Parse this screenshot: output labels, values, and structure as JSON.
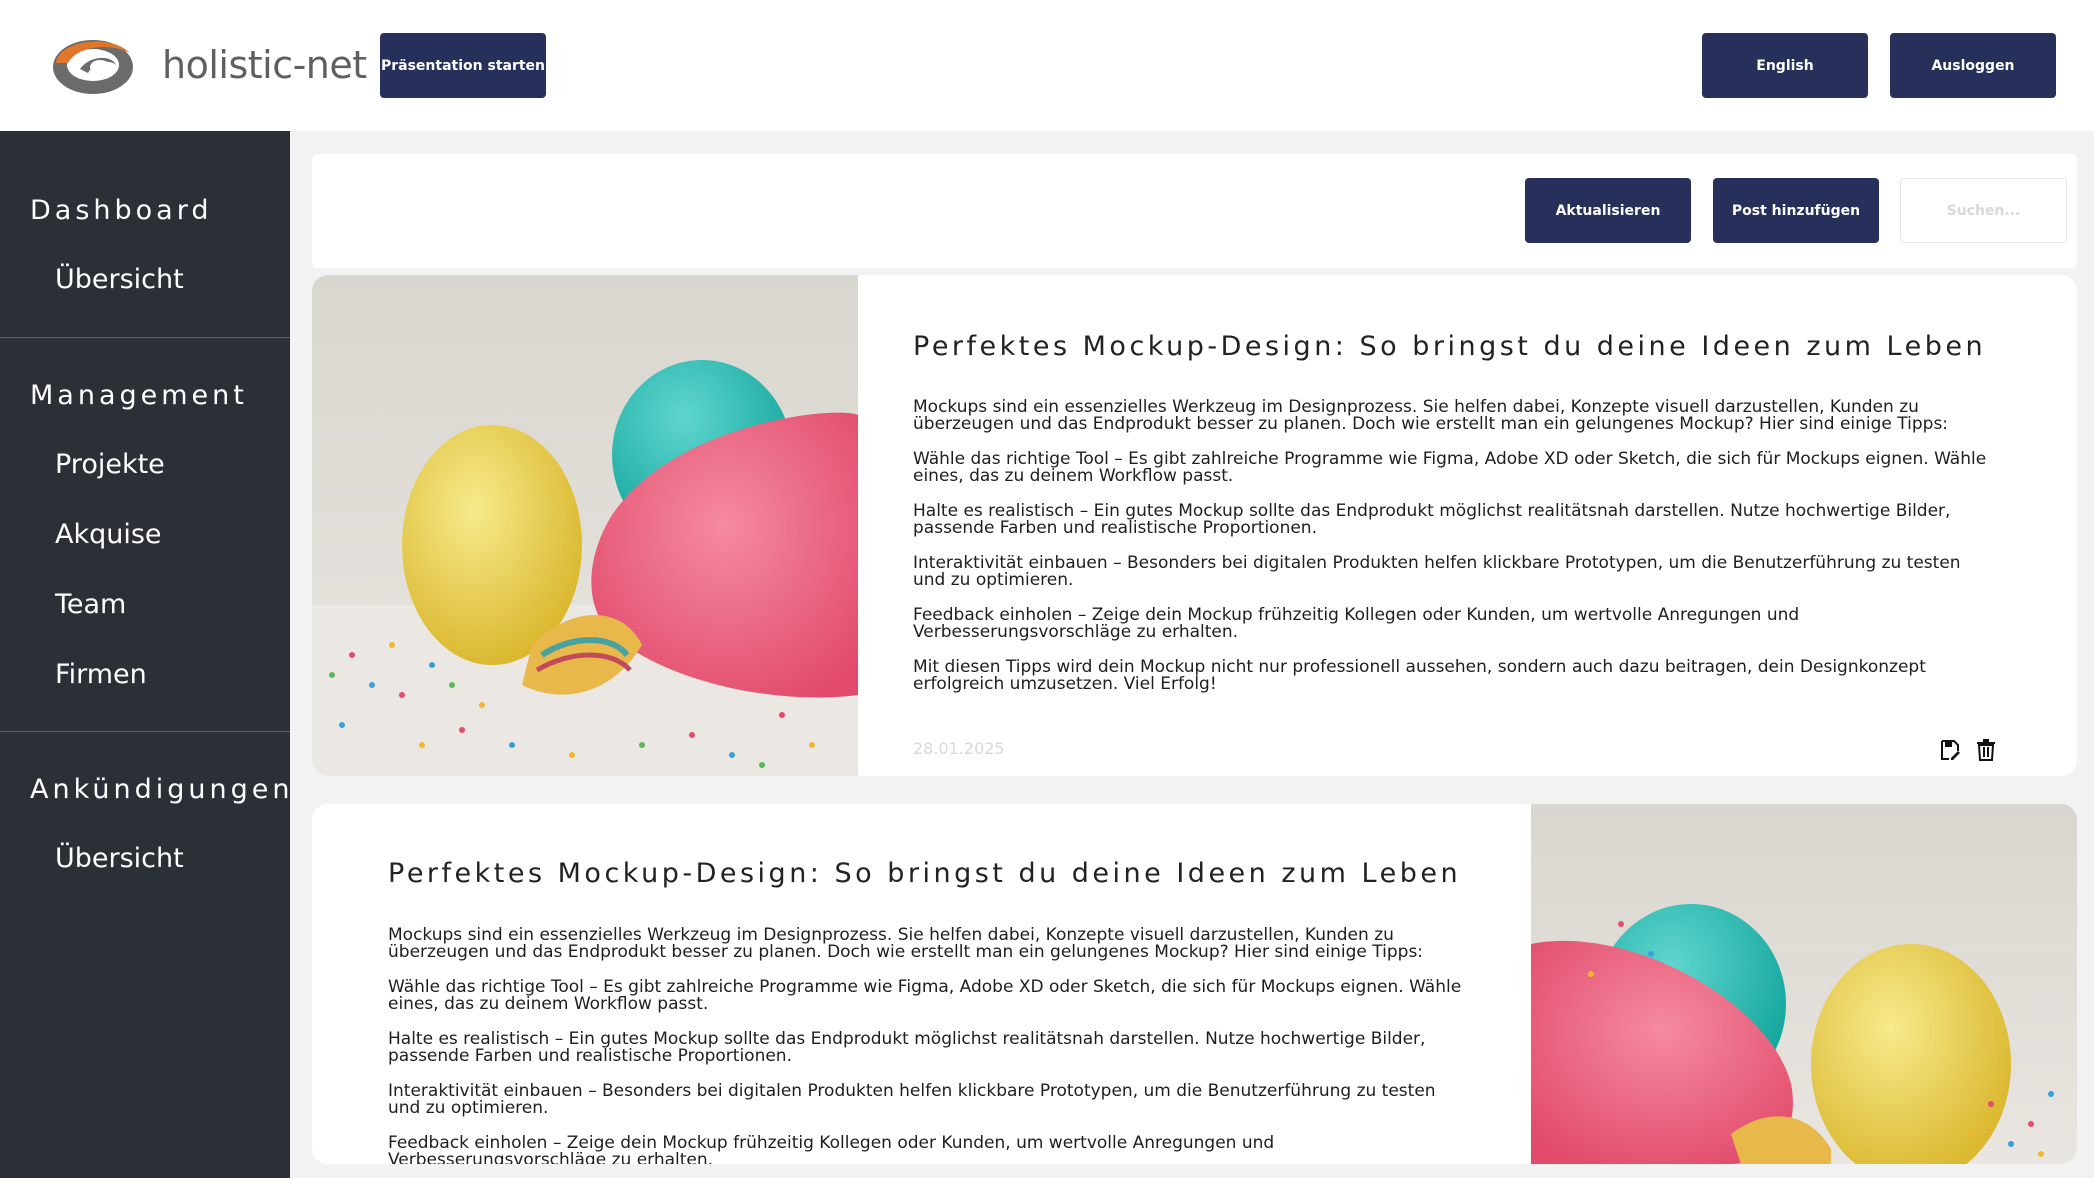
{
  "header": {
    "logo_text": "holistic-net",
    "present_button": "Präsentation starten",
    "language_button": "English",
    "logout_button": "Ausloggen"
  },
  "sidebar": {
    "sections": [
      {
        "heading": "Dashboard",
        "items": [
          "Übersicht"
        ]
      },
      {
        "heading": "Management",
        "items": [
          "Projekte",
          "Akquise",
          "Team",
          "Firmen"
        ]
      },
      {
        "heading": "Ankündigungen",
        "items": [
          "Übersicht"
        ]
      }
    ]
  },
  "toolbar": {
    "refresh_button": "Aktualisieren",
    "add_post_button": "Post hinzufügen",
    "search_placeholder": "Suchen..."
  },
  "posts": [
    {
      "title": "Perfektes Mockup-Design: So bringst du deine Ideen zum Leben",
      "paragraphs": [
        "Mockups sind ein essenzielles Werkzeug im Designprozess. Sie helfen dabei, Konzepte visuell darzustellen, Kunden zu überzeugen und das Endprodukt besser zu planen. Doch wie erstellt man ein gelungenes Mockup? Hier sind einige Tipps:",
        "Wähle das richtige Tool – Es gibt zahlreiche Programme wie Figma, Adobe XD oder Sketch, die sich für Mockups eignen. Wähle eines, das zu deinem Workflow passt.",
        "Halte es realistisch – Ein gutes Mockup sollte das Endprodukt möglichst realitätsnah darstellen. Nutze hochwertige Bilder, passende Farben und realistische Proportionen.",
        "Interaktivität einbauen – Besonders bei digitalen Produkten helfen klickbare Prototypen, um die Benutzerführung zu testen und zu optimieren.",
        "Feedback einholen – Zeige dein Mockup frühzeitig Kollegen oder Kunden, um wertvolle Anregungen und Verbesserungsvorschläge zu erhalten.",
        "Mit diesen Tipps wird dein Mockup nicht nur professionell aussehen, sondern auch dazu beitragen, dein Designkonzept erfolgreich umzusetzen. Viel Erfolg!"
      ],
      "date": "28.01.2025",
      "icons": [
        "edit-icon",
        "trash-icon"
      ]
    },
    {
      "title": "Perfektes Mockup-Design: So bringst du deine Ideen zum Leben",
      "paragraphs": [
        "Mockups sind ein essenzielles Werkzeug im Designprozess. Sie helfen dabei, Konzepte visuell darzustellen, Kunden zu überzeugen und das Endprodukt besser zu planen. Doch wie erstellt man ein gelungenes Mockup? Hier sind einige Tipps:",
        "Wähle das richtige Tool – Es gibt zahlreiche Programme wie Figma, Adobe XD oder Sketch, die sich für Mockups eignen. Wähle eines, das zu deinem Workflow passt.",
        "Halte es realistisch – Ein gutes Mockup sollte das Endprodukt möglichst realitätsnah darstellen. Nutze hochwertige Bilder, passende Farben und realistische Proportionen.",
        "Interaktivität einbauen – Besonders bei digitalen Produkten helfen klickbare Prototypen, um die Benutzerführung zu testen und zu optimieren.",
        "Feedback einholen – Zeige dein Mockup frühzeitig Kollegen oder Kunden, um wertvolle Anregungen und Verbesserungsvorschläge zu erhalten."
      ]
    }
  ],
  "colors": {
    "primary": "#26305a",
    "sidebar_bg": "#2b2f36",
    "page_bg": "#f2f2f2",
    "logo_orange": "#e0762a",
    "logo_gray": "#5f5f5f"
  }
}
